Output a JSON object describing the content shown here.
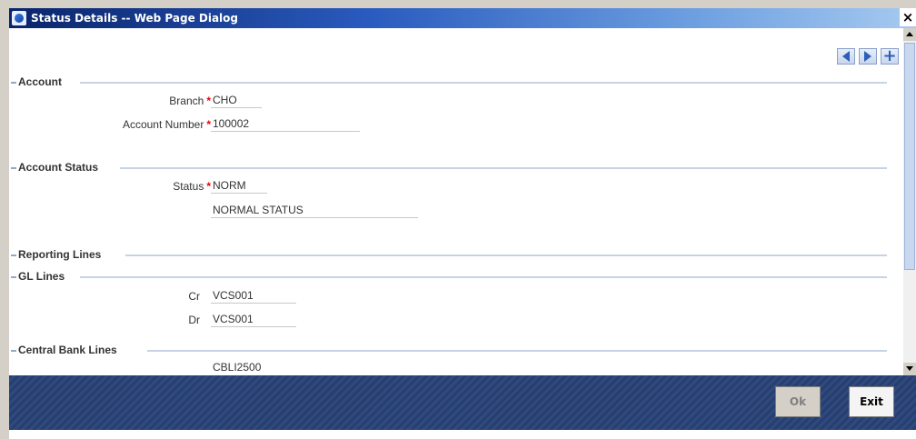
{
  "window": {
    "title": "Status Details -- Web Page Dialog",
    "close_label": "×"
  },
  "toolbar": {
    "items": [
      "previous-record",
      "next-record",
      "add-record"
    ],
    "add_label": "+"
  },
  "sections": {
    "account": "Account",
    "account_status": "Account Status",
    "reporting_lines": "Reporting Lines",
    "gl_lines": "GL Lines",
    "central_bank_lines": "Central Bank Lines"
  },
  "fields": {
    "branch": {
      "label": "Branch",
      "value": "CHO",
      "required_mark": "*"
    },
    "account_number": {
      "label": "Account Number",
      "value": "100002",
      "required_mark": "*"
    },
    "status": {
      "label": "Status",
      "value": "NORM",
      "required_mark": "*"
    },
    "status_description": {
      "value": "NORMAL STATUS"
    },
    "gl_cr": {
      "label": "Cr",
      "value": "VCS001"
    },
    "gl_dr": {
      "label": "Dr",
      "value": "VCS001"
    },
    "cb_line": {
      "value": "CBLI2500"
    }
  },
  "footer": {
    "ok_label": "Ok",
    "exit_label": "Exit"
  }
}
